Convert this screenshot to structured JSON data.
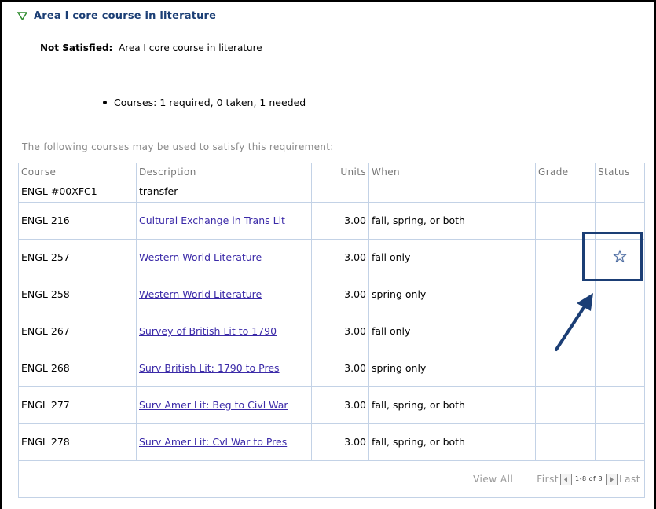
{
  "requirement": {
    "title": "Area I core course in literature",
    "status_label": "Not Satisfied:",
    "status_text": "Area I core course in literature",
    "courses_summary": "Courses: 1 required, 0 taken, 1 needed",
    "intro": "The following courses may be used to satisfy this requirement:"
  },
  "table": {
    "columns": [
      "Course",
      "Description",
      "Units",
      "When",
      "Grade",
      "Status"
    ],
    "rows": [
      {
        "course": "ENGL #00XFC1",
        "description": "transfer",
        "link": false,
        "units": "",
        "when": "",
        "grade": "",
        "status": ""
      },
      {
        "course": "ENGL 216",
        "description": "Cultural Exchange in Trans Lit",
        "link": true,
        "units": "3.00",
        "when": "fall, spring, or both",
        "grade": "",
        "status": ""
      },
      {
        "course": "ENGL 257",
        "description": "Western World Literature",
        "link": true,
        "units": "3.00",
        "when": "fall only",
        "grade": "",
        "status": "star-icon"
      },
      {
        "course": "ENGL 258",
        "description": "Western World Literature",
        "link": true,
        "units": "3.00",
        "when": "spring only",
        "grade": "",
        "status": ""
      },
      {
        "course": "ENGL 267",
        "description": "Survey of British Lit to 1790",
        "link": true,
        "units": "3.00",
        "when": "fall only",
        "grade": "",
        "status": ""
      },
      {
        "course": "ENGL 268",
        "description": "Surv British Lit: 1790 to Pres",
        "link": true,
        "units": "3.00",
        "when": "spring only",
        "grade": "",
        "status": ""
      },
      {
        "course": "ENGL 277",
        "description": "Surv Amer Lit: Beg to Civl War",
        "link": true,
        "units": "3.00",
        "when": "fall, spring, or both",
        "grade": "",
        "status": ""
      },
      {
        "course": "ENGL 278",
        "description": "Surv Amer Lit: Cvl War to Pres",
        "link": true,
        "units": "3.00",
        "when": "fall, spring, or both",
        "grade": "",
        "status": ""
      }
    ]
  },
  "pager": {
    "view_all": "View All",
    "first": "First",
    "range": "1-8 of 8",
    "last": "Last"
  },
  "colors": {
    "title": "#1b3e75",
    "link": "#3b2aa8",
    "grid": "#c3d2e6",
    "highlight": "#1b3e75"
  }
}
